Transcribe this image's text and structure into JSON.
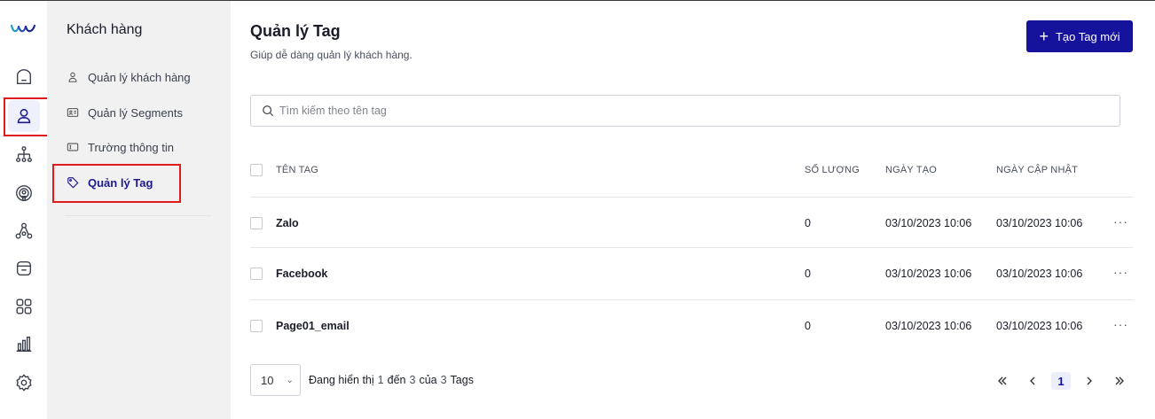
{
  "rail": {
    "logo": "logo-icon",
    "items": [
      {
        "icon": "home-icon"
      },
      {
        "icon": "user-icon"
      },
      {
        "icon": "hierarchy-icon"
      },
      {
        "icon": "broadcast-icon"
      },
      {
        "icon": "network-icon"
      },
      {
        "icon": "archive-icon"
      },
      {
        "icon": "apps-grid-icon"
      },
      {
        "icon": "bar-chart-icon"
      },
      {
        "icon": "gear-icon"
      }
    ]
  },
  "sidebar": {
    "title": "Khách hàng",
    "items": [
      {
        "label": "Quản lý khách hàng",
        "icon": "user-icon"
      },
      {
        "label": "Quản lý Segments",
        "icon": "id-card-icon"
      },
      {
        "label": "Trường thông tin",
        "icon": "field-icon"
      },
      {
        "label": "Quản lý Tag",
        "icon": "tag-icon"
      }
    ]
  },
  "header": {
    "title": "Quản lý Tag",
    "subtitle": "Giúp dễ dàng quản lý khách hàng.",
    "create_label": "Tạo Tag mới"
  },
  "search": {
    "placeholder": "Tìm kiếm theo tên tag"
  },
  "table": {
    "columns": [
      "TÊN TAG",
      "SỐ LƯỢNG",
      "NGÀY TẠO",
      "NGÀY CẬP NHẬT"
    ],
    "rows": [
      {
        "name": "Zalo",
        "count": "0",
        "created": "03/10/2023 10:06",
        "updated": "03/10/2023 10:06",
        "more": "···"
      },
      {
        "name": "Facebook",
        "count": "0",
        "created": "03/10/2023 10:06",
        "updated": "03/10/2023 10:06",
        "more": "···"
      },
      {
        "name": "Page01_email",
        "count": "0",
        "created": "03/10/2023 10:06",
        "updated": "03/10/2023 10:06",
        "more": "···"
      }
    ]
  },
  "pagination": {
    "page_size": "10",
    "info_prefix": "Đang hiển thị",
    "from": "1",
    "to_word": "đến",
    "to": "3",
    "of_word": "của",
    "total": "3",
    "suffix": "Tags",
    "current_page": "1"
  },
  "colors": {
    "primary": "#15129c",
    "highlight_box": "#e01b1b",
    "sidebar_bg": "#f1f1f1"
  }
}
